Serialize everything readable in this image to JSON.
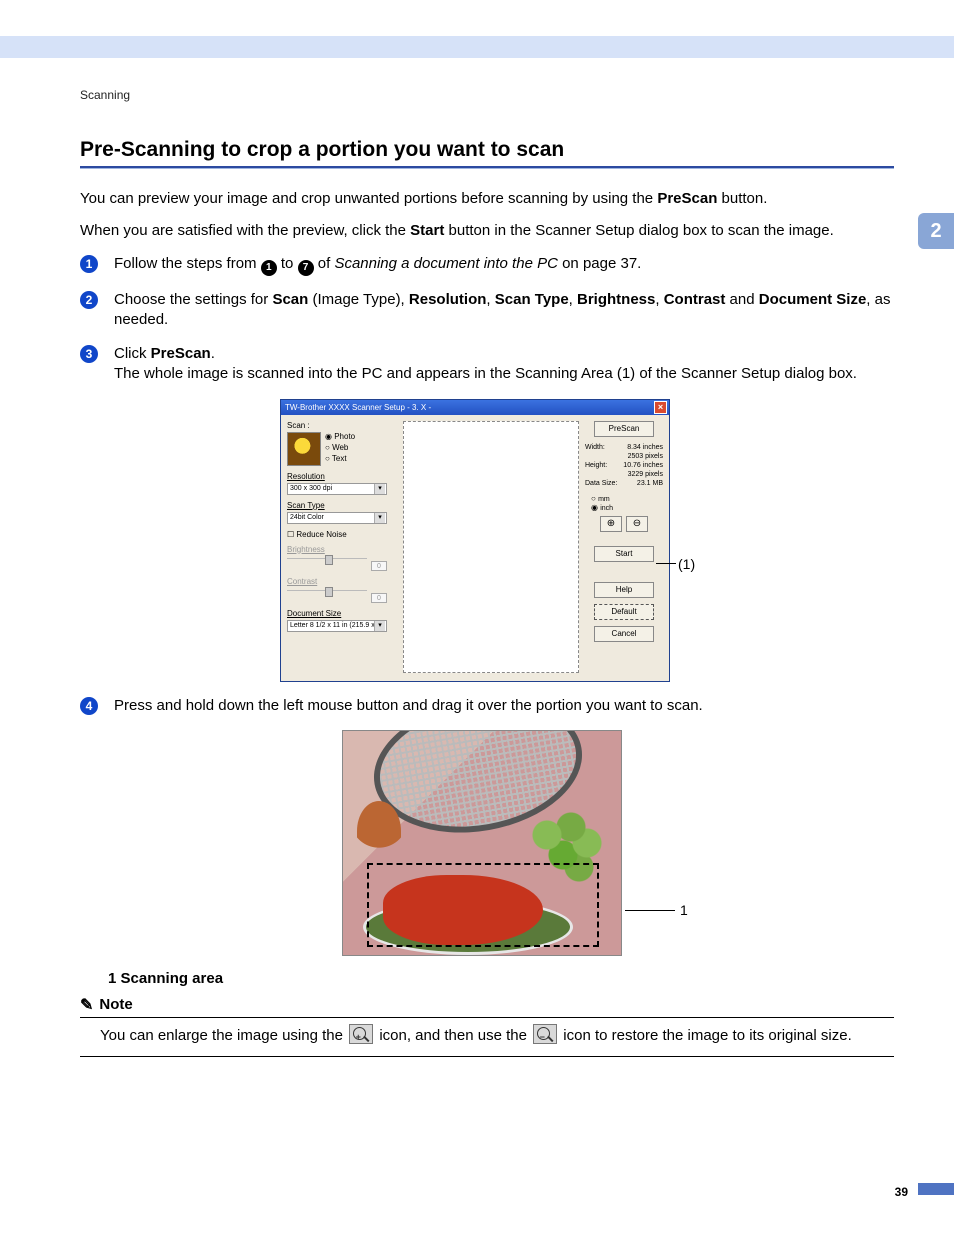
{
  "header": {
    "section_label": "Scanning",
    "chapter_tab": "2",
    "page_number": "39"
  },
  "heading": "Pre-Scanning to crop a portion you want to scan",
  "intro": {
    "p1_a": "You can preview your image and crop unwanted portions before scanning by using the ",
    "p1_bold": "PreScan",
    "p1_b": " button.",
    "p2_a": "When you are satisfied with the preview, click the ",
    "p2_bold": "Start",
    "p2_b": " button in the Scanner Setup dialog box to scan the image."
  },
  "steps": {
    "s1": {
      "a": "Follow the steps from ",
      "c1": "1",
      "b": " to ",
      "c2": "7",
      "c": " of ",
      "ital": "Scanning a document into the PC",
      "d": " on page 37."
    },
    "s2": {
      "a": "Choose the settings for ",
      "b1": "Scan",
      "b": " (Image Type), ",
      "b2": "Resolution",
      "c": ", ",
      "b3": "Scan Type",
      "d": ", ",
      "b4": "Brightness",
      "e": ", ",
      "b5": "Contrast",
      "f": " and ",
      "b6": "Document Size",
      "g": ", as needed."
    },
    "s3": {
      "a": "Click ",
      "bold": "PreScan",
      "b": ".",
      "line2": "The whole image is scanned into the PC and appears in the Scanning Area (1) of the Scanner Setup dialog box."
    },
    "s4": "Press and hold down the left mouse button and drag it over the portion you want to scan."
  },
  "dialog": {
    "title": "TW-Brother XXXX Scanner Setup - 3. X -",
    "scan_label": "Scan :",
    "radios": {
      "photo": "Photo",
      "web": "Web",
      "text": "Text"
    },
    "resolution_label": "Resolution",
    "resolution_value": "300 x 300 dpi",
    "scantype_label": "Scan Type",
    "scantype_value": "24bit Color",
    "reduce_noise": "Reduce Noise",
    "brightness_label": "Brightness",
    "brightness_value": "0",
    "contrast_label": "Contrast",
    "contrast_value": "0",
    "docsize_label": "Document Size",
    "docsize_value": "Letter 8 1/2 x 11 in (215.9 x",
    "btn_prescan": "PreScan",
    "info": {
      "width_l": "Width:",
      "width_v": "8.34 inches",
      "width_px": "2503 pixels",
      "height_l": "Height:",
      "height_v": "10.76 inches",
      "height_px": "3229 pixels",
      "dsize_l": "Data Size:",
      "dsize_v": "23.1 MB"
    },
    "unit_mm": "mm",
    "unit_inch": "inch",
    "btn_start": "Start",
    "btn_help": "Help",
    "btn_default": "Default",
    "btn_cancel": "Cancel",
    "callout": "(1)"
  },
  "photo": {
    "callout": "1"
  },
  "legend": "1   Scanning area",
  "note": {
    "label": "Note",
    "a": "You can enlarge the image using the ",
    "b": " icon, and then use the ",
    "c": " icon to restore the image to its original size."
  }
}
